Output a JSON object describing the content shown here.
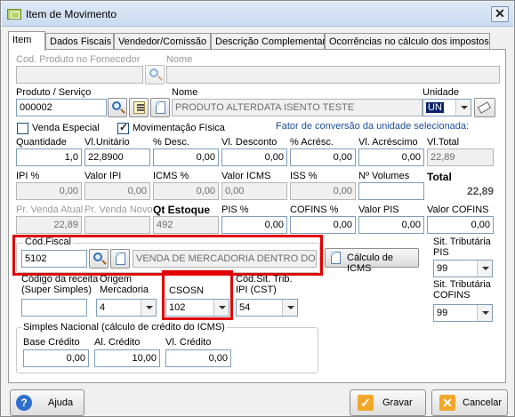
{
  "window": {
    "title": "Item de Movimento",
    "close": "✕"
  },
  "tabs": [
    "Item",
    "Dados Fiscais",
    "Vendedor/Comissão",
    "Descrição Complementar",
    "Ocorrências no cálculo dos impostos"
  ],
  "labels": {
    "cod_forn": "Cod. Produto no Fornecedor",
    "nome_top": "Nome",
    "produto": "Produto / Serviço",
    "nome": "Nome",
    "unidade": "Unidade",
    "venda_especial": "Venda Especial",
    "mov_fisica": "Movimentação Física",
    "fator": "Fator de conversão da unidade selecionada:",
    "quantidade": "Quantidade",
    "vl_unit": "Vl.Unitário",
    "desc_pct": "% Desc.",
    "vl_desc": "Vl. Desconto",
    "acresc_pct": "% Acrésc.",
    "vl_acresc": "Vl. Acréscimo",
    "vl_total": "Vl.Total",
    "ipi_pct": "IPI %",
    "valor_ipi": "Valor IPI",
    "icms_pct": "ICMS %",
    "valor_icms": "Valor ICMS",
    "iss_pct": "ISS %",
    "n_volumes": "Nº Volumes",
    "total": "Total",
    "pr_venda_atual": "Pr. Venda Atual",
    "pr_venda_novo": "Pr. Venda Novo",
    "qt_estoque": "Qt Estoque",
    "pis_pct": "PIS %",
    "cofins_pct": "COFINS %",
    "valor_pis": "Valor PIS",
    "valor_cofins": "Valor COFINS",
    "cod_fiscal": "Cód.Fiscal",
    "calc_icms": "Cálculo de ICMS",
    "sit_pis_1": "Sit. Tributária",
    "sit_pis_2": "PIS",
    "cod_receita_1": "Código da receita",
    "cod_receita_2": "(Super Simples)",
    "origem_1": "Origem",
    "origem_2": "Mercadoria",
    "csosn": "CSOSN",
    "cod_sit_1": "Cód.Sit. Trib.",
    "cod_sit_2": "IPI (CST)",
    "sit_cofins_1": "Sit. Tributária",
    "sit_cofins_2": "COFINS",
    "simples": "Simples Nacional (cálculo de crédito do ICMS)",
    "base_credito": "Base Crédito",
    "al_credito": "Al. Crédito",
    "vl_credito": "Vl. Crédito"
  },
  "values": {
    "produto": "000002",
    "nome": "PRODUTO ALTERDATA ISENTO TESTE",
    "unidade": "UN",
    "quantidade": "1,0",
    "vl_unit": "22,8900",
    "desc_pct": "0,00",
    "vl_desc": "0,00",
    "acresc_pct": "0,00",
    "vl_acresc": "0,00",
    "vl_total": "22,89",
    "ipi_pct": "0,00",
    "valor_ipi": "0,00",
    "icms_pct": "0,00",
    "valor_icms": "0,00",
    "iss_pct": "0,00",
    "n_volumes": "",
    "total": "22,89",
    "pr_venda_atual": "22,89",
    "pr_venda_novo": "",
    "qt_estoque": "492",
    "pis_pct": "0,00",
    "cofins_pct": "0,00",
    "valor_pis": "0,00",
    "valor_cofins": "0,00",
    "cod_fiscal": "5102",
    "cod_fiscal_desc": "VENDA DE MERCADORIA DENTRO DO EST",
    "sit_pis": "99",
    "cod_receita": "",
    "origem": "4",
    "csosn": "102",
    "cod_sit": "54",
    "sit_cofins": "99",
    "base_credito": "0,00",
    "al_credito": "10,00",
    "vl_credito": "0,00"
  },
  "buttons": {
    "ajuda": "Ajuda",
    "gravar": "Gravar",
    "cancelar": "Cancelar"
  },
  "colors": {
    "highlight": "#e10000",
    "accent": "#0a246a",
    "fator_text": "#1b4f9c"
  }
}
